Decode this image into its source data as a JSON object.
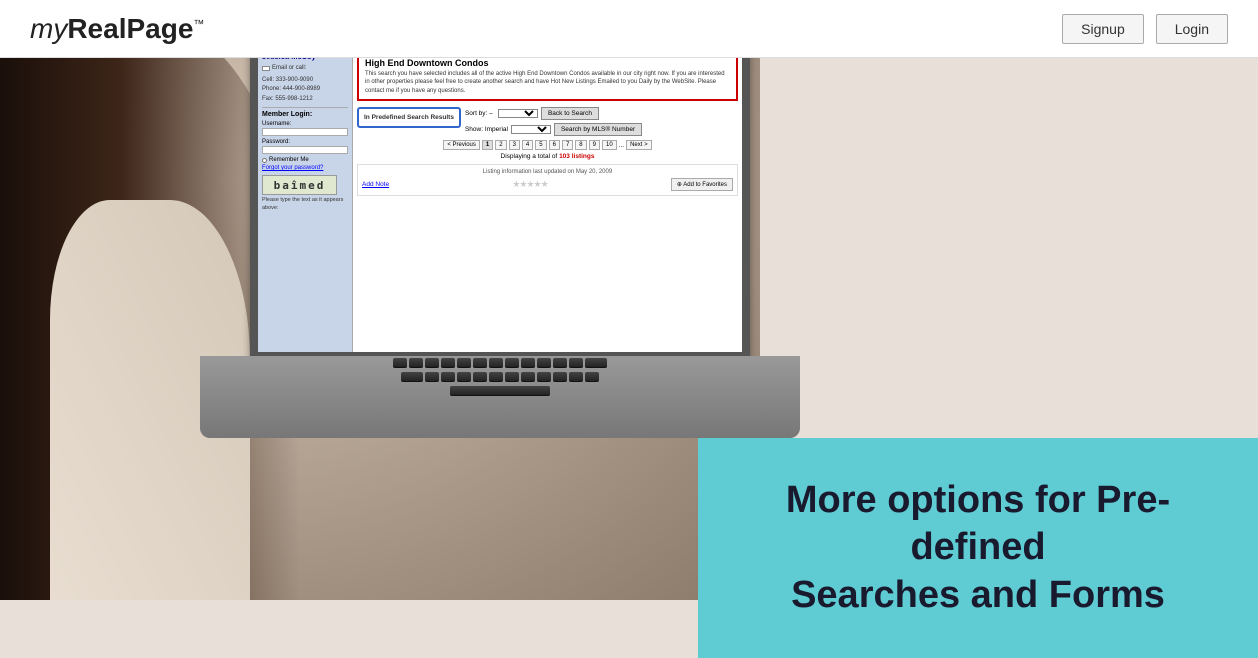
{
  "header": {
    "logo": "myRealPage",
    "logo_my": "my",
    "logo_realpage": "RealPage",
    "logo_tm": "™",
    "nav": {
      "signup": "Signup",
      "login": "Login"
    }
  },
  "screen": {
    "sidebar": {
      "agent_name": "Jessica McCoy",
      "email_label": "Email or call:",
      "cell": "Cell: 333-900-9090",
      "phone": "Phone: 444-900-8989",
      "fax": "Fax: 555-998-1212",
      "member_login": "Member Login:",
      "username_label": "Username:",
      "password_label": "Password:",
      "remember_me": "Remember Me",
      "forgot_password": "Forgot your password?",
      "captcha_text": "baîmed",
      "captcha_note": "Please type the text as it appears above:"
    },
    "main": {
      "search_title": "High End Downtown Condos",
      "search_description": "This search you have selected includes all of the active High End Downtown Condos available in our city right now. If you are interested in other properties please feel free to create another search and have Hot New Listings Emailed to you Daily by the WebSite. Please contact me if you have any questions.",
      "tooltip_label": "In Predefined Search Results",
      "sort_by_label": "Sort by: –",
      "show_label": "Show: Imperial",
      "back_to_search": "Back to Search",
      "search_by_mls": "Search by MLS® Number",
      "prev_btn": "< Previous",
      "next_btn": "Next >",
      "pages": [
        "1",
        "2",
        "3",
        "4",
        "5",
        "6",
        "7",
        "8",
        "9",
        "10",
        "..."
      ],
      "displaying_text": "Displaying a total of",
      "count": "103 listings",
      "listing_info": "Listing information last updated on May 20, 2009",
      "add_note": "Add Note",
      "add_to_favorites": "⊕ Add to Favorites"
    }
  },
  "overlay": {
    "line1": "More options for Pre-defined",
    "line2": "Searches and Forms"
  }
}
